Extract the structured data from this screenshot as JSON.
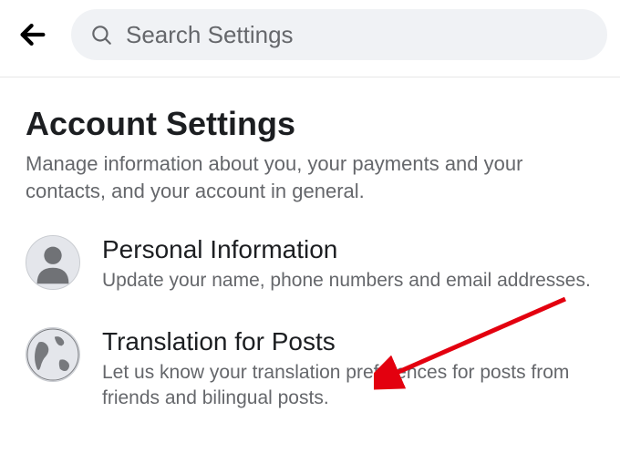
{
  "search": {
    "placeholder": "Search Settings"
  },
  "page": {
    "title": "Account Settings",
    "subtitle": "Manage information about you, your payments and your contacts, and your account in general."
  },
  "settings": [
    {
      "title": "Personal Information",
      "desc": "Update your name, phone numbers and email addresses."
    },
    {
      "title": "Translation for Posts",
      "desc": "Let us know your translation preferences for posts from friends and bilingual posts."
    }
  ]
}
